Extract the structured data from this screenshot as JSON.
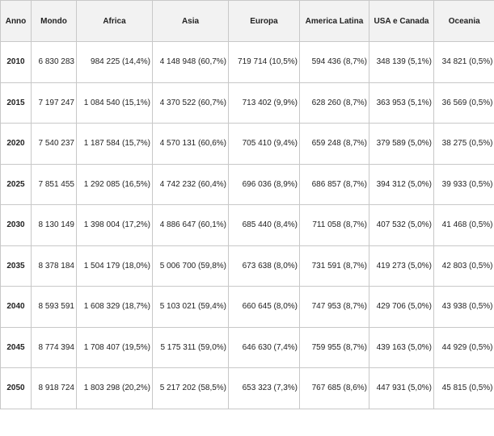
{
  "table": {
    "headers": [
      "Anno",
      "Mondo",
      "Africa",
      "Asia",
      "Europa",
      "America Latina",
      "USA e Canada",
      "Oceania"
    ],
    "rows": [
      [
        "2010",
        "6 830 283",
        "984 225 (14,4%)",
        "4 148 948 (60,7%)",
        "719 714 (10,5%)",
        "594 436 (8,7%)",
        "348 139 (5,1%)",
        "34 821 (0,5%)"
      ],
      [
        "2015",
        "7 197 247",
        "1 084 540 (15,1%)",
        "4 370 522 (60,7%)",
        "713 402 (9,9%)",
        "628 260 (8,7%)",
        "363 953 (5,1%)",
        "36 569 (0,5%)"
      ],
      [
        "2020",
        "7 540 237",
        "1 187 584 (15,7%)",
        "4 570 131 (60,6%)",
        "705 410 (9,4%)",
        "659 248 (8,7%)",
        "379 589 (5,0%)",
        "38 275 (0,5%)"
      ],
      [
        "2025",
        "7 851 455",
        "1 292 085 (16,5%)",
        "4 742 232 (60,4%)",
        "696 036 (8,9%)",
        "686 857 (8,7%)",
        "394 312 (5,0%)",
        "39 933 (0,5%)"
      ],
      [
        "2030",
        "8 130 149",
        "1 398 004 (17,2%)",
        "4 886 647 (60,1%)",
        "685 440 (8,4%)",
        "711 058 (8,7%)",
        "407 532 (5,0%)",
        "41 468 (0,5%)"
      ],
      [
        "2035",
        "8 378 184",
        "1 504 179 (18,0%)",
        "5 006 700 (59,8%)",
        "673 638 (8,0%)",
        "731 591 (8,7%)",
        "419 273 (5,0%)",
        "42 803 (0,5%)"
      ],
      [
        "2040",
        "8 593 591",
        "1 608 329 (18,7%)",
        "5 103 021 (59,4%)",
        "660 645 (8,0%)",
        "747 953 (8,7%)",
        "429 706 (5,0%)",
        "43 938 (0,5%)"
      ],
      [
        "2045",
        "8 774 394",
        "1 708 407 (19,5%)",
        "5 175 311 (59,0%)",
        "646 630 (7,4%)",
        "759 955 (8,7%)",
        "439 163 (5,0%)",
        "44 929 (0,5%)"
      ],
      [
        "2050",
        "8 918 724",
        "1 803 298 (20,2%)",
        "5 217 202 (58,5%)",
        "653 323 (7,3%)",
        "767 685 (8,6%)",
        "447 931 (5,0%)",
        "45 815 (0,5%)"
      ]
    ]
  }
}
